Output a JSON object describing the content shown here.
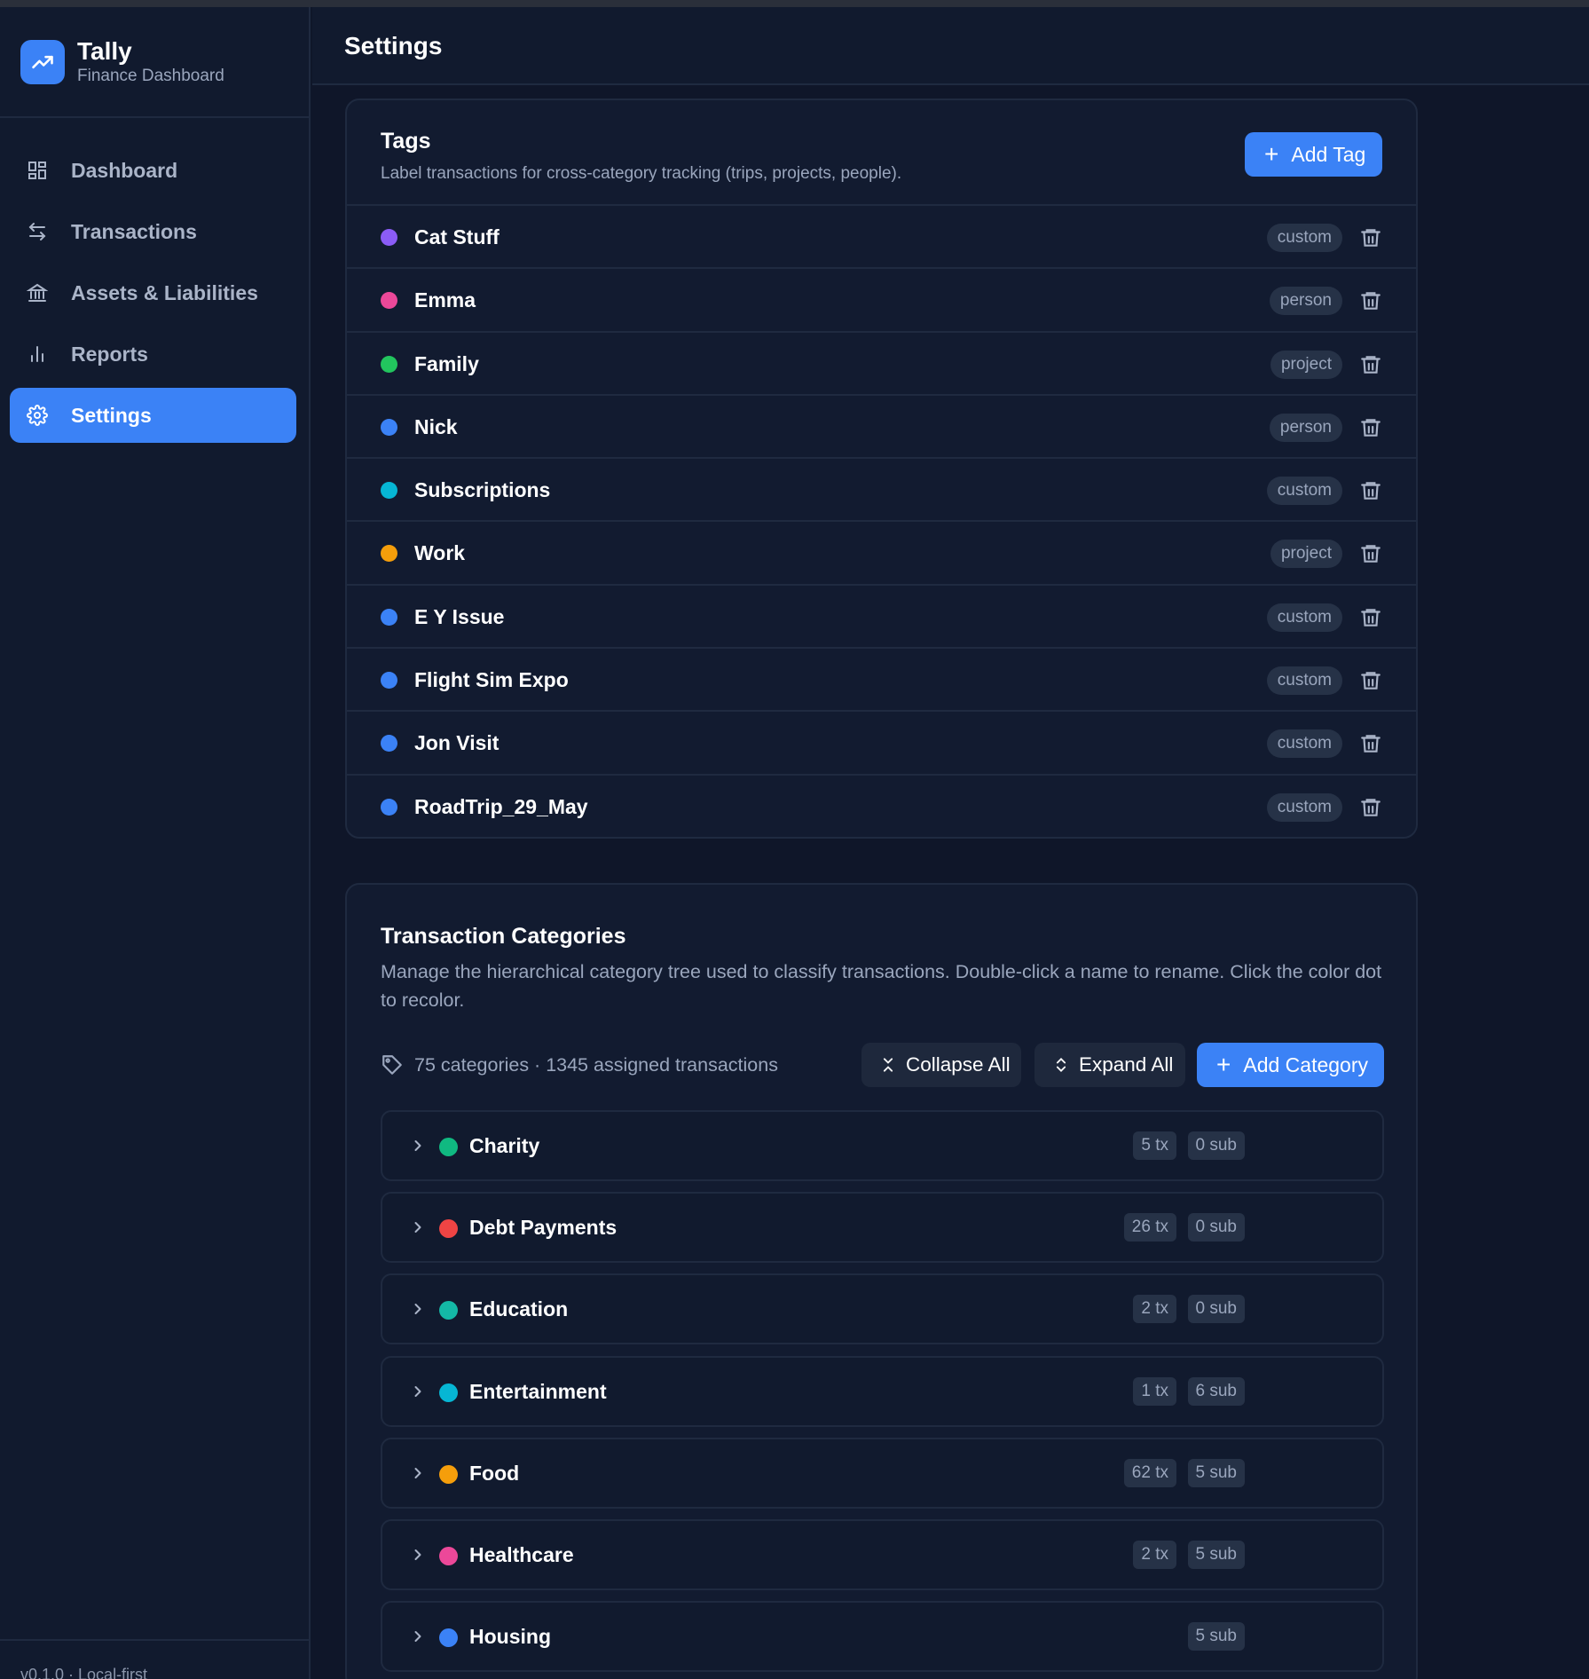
{
  "app": {
    "name": "Tally",
    "subtitle": "Finance Dashboard"
  },
  "sidebar": {
    "items": [
      {
        "label": "Dashboard",
        "icon": "dashboard-icon",
        "active": false
      },
      {
        "label": "Transactions",
        "icon": "arrows-icon",
        "active": false
      },
      {
        "label": "Assets & Liabilities",
        "icon": "bank-icon",
        "active": false
      },
      {
        "label": "Reports",
        "icon": "bar-chart-icon",
        "active": false
      },
      {
        "label": "Settings",
        "icon": "gear-icon",
        "active": true
      }
    ],
    "footer": "v0.1.0 · Local-first"
  },
  "header": {
    "title": "Settings"
  },
  "tags": {
    "title": "Tags",
    "description": "Label transactions for cross-category tracking (trips, projects, people).",
    "add_label": "Add Tag",
    "items": [
      {
        "name": "Cat Stuff",
        "type": "custom",
        "color": "#8b5cf6"
      },
      {
        "name": "Emma",
        "type": "person",
        "color": "#ec4899"
      },
      {
        "name": "Family",
        "type": "project",
        "color": "#22c55e"
      },
      {
        "name": "Nick",
        "type": "person",
        "color": "#3b82f6"
      },
      {
        "name": "Subscriptions",
        "type": "custom",
        "color": "#06b6d4"
      },
      {
        "name": "Work",
        "type": "project",
        "color": "#f59e0b"
      },
      {
        "name": "E Y Issue",
        "type": "custom",
        "color": "#3b82f6"
      },
      {
        "name": "Flight Sim Expo",
        "type": "custom",
        "color": "#3b82f6"
      },
      {
        "name": "Jon Visit",
        "type": "custom",
        "color": "#3b82f6"
      },
      {
        "name": "RoadTrip_29_May",
        "type": "custom",
        "color": "#3b82f6"
      }
    ]
  },
  "categories": {
    "title": "Transaction Categories",
    "description": "Manage the hierarchical category tree used to classify transactions. Double-click a name to rename. Click the color dot to recolor.",
    "summary": "75 categories · 1345 assigned transactions",
    "collapse_label": "Collapse All",
    "expand_label": "Expand All",
    "add_label": "Add Category",
    "items": [
      {
        "name": "Charity",
        "tx": "5 tx",
        "sub": "0 sub",
        "color": "#10b981"
      },
      {
        "name": "Debt Payments",
        "tx": "26 tx",
        "sub": "0 sub",
        "color": "#ef4444"
      },
      {
        "name": "Education",
        "tx": "2 tx",
        "sub": "0 sub",
        "color": "#14b8a6"
      },
      {
        "name": "Entertainment",
        "tx": "1 tx",
        "sub": "6 sub",
        "color": "#06b6d4"
      },
      {
        "name": "Food",
        "tx": "62 tx",
        "sub": "5 sub",
        "color": "#f59e0b"
      },
      {
        "name": "Healthcare",
        "tx": "2 tx",
        "sub": "5 sub",
        "color": "#ec4899"
      },
      {
        "name": "Housing",
        "tx": "",
        "sub": "5 sub",
        "color": "#3b82f6"
      }
    ]
  }
}
